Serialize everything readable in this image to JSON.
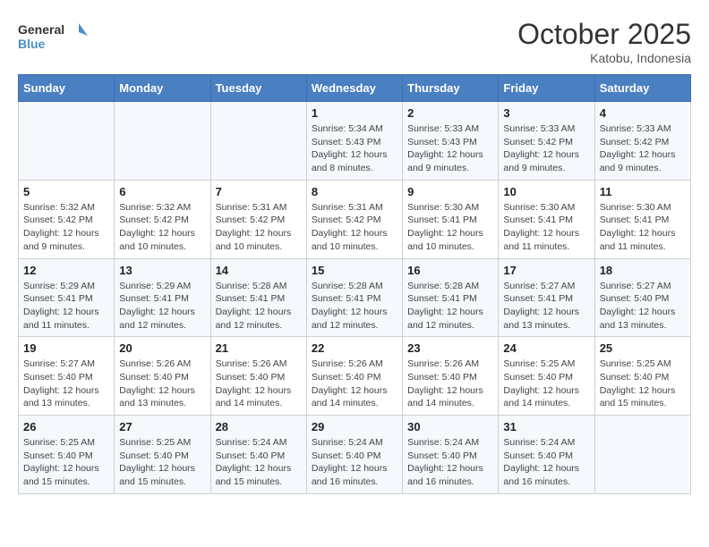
{
  "logo": {
    "line1": "General",
    "line2": "Blue"
  },
  "title": "October 2025",
  "location": "Katobu, Indonesia",
  "weekdays": [
    "Sunday",
    "Monday",
    "Tuesday",
    "Wednesday",
    "Thursday",
    "Friday",
    "Saturday"
  ],
  "rows": [
    [
      {
        "day": "",
        "info": ""
      },
      {
        "day": "",
        "info": ""
      },
      {
        "day": "",
        "info": ""
      },
      {
        "day": "1",
        "info": "Sunrise: 5:34 AM\nSunset: 5:43 PM\nDaylight: 12 hours and 8 minutes."
      },
      {
        "day": "2",
        "info": "Sunrise: 5:33 AM\nSunset: 5:43 PM\nDaylight: 12 hours and 9 minutes."
      },
      {
        "day": "3",
        "info": "Sunrise: 5:33 AM\nSunset: 5:42 PM\nDaylight: 12 hours and 9 minutes."
      },
      {
        "day": "4",
        "info": "Sunrise: 5:33 AM\nSunset: 5:42 PM\nDaylight: 12 hours and 9 minutes."
      }
    ],
    [
      {
        "day": "5",
        "info": "Sunrise: 5:32 AM\nSunset: 5:42 PM\nDaylight: 12 hours and 9 minutes."
      },
      {
        "day": "6",
        "info": "Sunrise: 5:32 AM\nSunset: 5:42 PM\nDaylight: 12 hours and 10 minutes."
      },
      {
        "day": "7",
        "info": "Sunrise: 5:31 AM\nSunset: 5:42 PM\nDaylight: 12 hours and 10 minutes."
      },
      {
        "day": "8",
        "info": "Sunrise: 5:31 AM\nSunset: 5:42 PM\nDaylight: 12 hours and 10 minutes."
      },
      {
        "day": "9",
        "info": "Sunrise: 5:30 AM\nSunset: 5:41 PM\nDaylight: 12 hours and 10 minutes."
      },
      {
        "day": "10",
        "info": "Sunrise: 5:30 AM\nSunset: 5:41 PM\nDaylight: 12 hours and 11 minutes."
      },
      {
        "day": "11",
        "info": "Sunrise: 5:30 AM\nSunset: 5:41 PM\nDaylight: 12 hours and 11 minutes."
      }
    ],
    [
      {
        "day": "12",
        "info": "Sunrise: 5:29 AM\nSunset: 5:41 PM\nDaylight: 12 hours and 11 minutes."
      },
      {
        "day": "13",
        "info": "Sunrise: 5:29 AM\nSunset: 5:41 PM\nDaylight: 12 hours and 12 minutes."
      },
      {
        "day": "14",
        "info": "Sunrise: 5:28 AM\nSunset: 5:41 PM\nDaylight: 12 hours and 12 minutes."
      },
      {
        "day": "15",
        "info": "Sunrise: 5:28 AM\nSunset: 5:41 PM\nDaylight: 12 hours and 12 minutes."
      },
      {
        "day": "16",
        "info": "Sunrise: 5:28 AM\nSunset: 5:41 PM\nDaylight: 12 hours and 12 minutes."
      },
      {
        "day": "17",
        "info": "Sunrise: 5:27 AM\nSunset: 5:41 PM\nDaylight: 12 hours and 13 minutes."
      },
      {
        "day": "18",
        "info": "Sunrise: 5:27 AM\nSunset: 5:40 PM\nDaylight: 12 hours and 13 minutes."
      }
    ],
    [
      {
        "day": "19",
        "info": "Sunrise: 5:27 AM\nSunset: 5:40 PM\nDaylight: 12 hours and 13 minutes."
      },
      {
        "day": "20",
        "info": "Sunrise: 5:26 AM\nSunset: 5:40 PM\nDaylight: 12 hours and 13 minutes."
      },
      {
        "day": "21",
        "info": "Sunrise: 5:26 AM\nSunset: 5:40 PM\nDaylight: 12 hours and 14 minutes."
      },
      {
        "day": "22",
        "info": "Sunrise: 5:26 AM\nSunset: 5:40 PM\nDaylight: 12 hours and 14 minutes."
      },
      {
        "day": "23",
        "info": "Sunrise: 5:26 AM\nSunset: 5:40 PM\nDaylight: 12 hours and 14 minutes."
      },
      {
        "day": "24",
        "info": "Sunrise: 5:25 AM\nSunset: 5:40 PM\nDaylight: 12 hours and 14 minutes."
      },
      {
        "day": "25",
        "info": "Sunrise: 5:25 AM\nSunset: 5:40 PM\nDaylight: 12 hours and 15 minutes."
      }
    ],
    [
      {
        "day": "26",
        "info": "Sunrise: 5:25 AM\nSunset: 5:40 PM\nDaylight: 12 hours and 15 minutes."
      },
      {
        "day": "27",
        "info": "Sunrise: 5:25 AM\nSunset: 5:40 PM\nDaylight: 12 hours and 15 minutes."
      },
      {
        "day": "28",
        "info": "Sunrise: 5:24 AM\nSunset: 5:40 PM\nDaylight: 12 hours and 15 minutes."
      },
      {
        "day": "29",
        "info": "Sunrise: 5:24 AM\nSunset: 5:40 PM\nDaylight: 12 hours and 16 minutes."
      },
      {
        "day": "30",
        "info": "Sunrise: 5:24 AM\nSunset: 5:40 PM\nDaylight: 12 hours and 16 minutes."
      },
      {
        "day": "31",
        "info": "Sunrise: 5:24 AM\nSunset: 5:40 PM\nDaylight: 12 hours and 16 minutes."
      },
      {
        "day": "",
        "info": ""
      }
    ]
  ]
}
